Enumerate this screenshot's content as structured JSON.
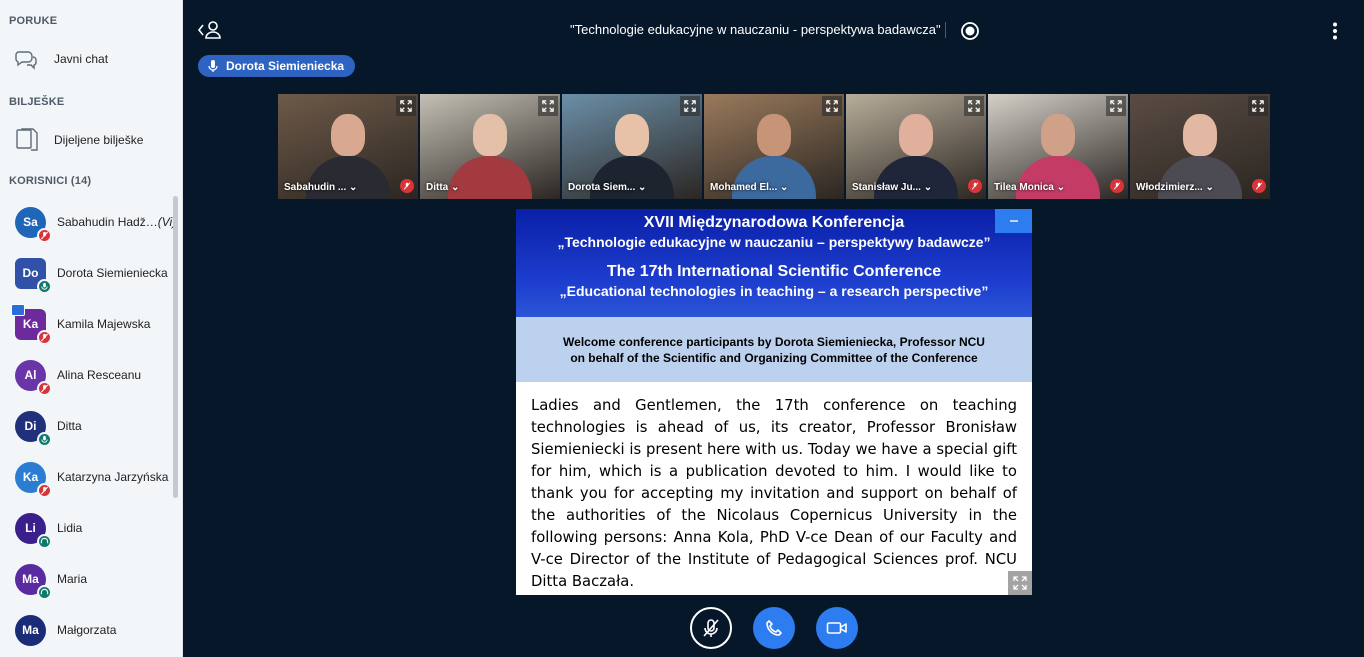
{
  "sidebar": {
    "messages_title": "PORUKE",
    "public_chat_label": "Javni chat",
    "notes_title": "BILJEŠKE",
    "shared_notes_label": "Dijeljene bilješke",
    "users_title": "KORISNICI (14)",
    "users": [
      {
        "initials": "Sa",
        "name": "Sabahudin Hadž…",
        "suffix": "(Vi)",
        "color": "#1f66b8",
        "status": "muted"
      },
      {
        "initials": "Do",
        "name": "Dorota Siemieniecka",
        "suffix": "",
        "color": "#3150a8",
        "status": "live",
        "shape": "square"
      },
      {
        "initials": "Ka",
        "name": "Kamila Majewska",
        "suffix": "",
        "color": "#6c2a9c",
        "status": "muted",
        "shape": "square",
        "presenter": true
      },
      {
        "initials": "Al",
        "name": "Alina Resceanu",
        "suffix": "",
        "color": "#6a35a8",
        "status": "muted"
      },
      {
        "initials": "Di",
        "name": "Ditta",
        "suffix": "",
        "color": "#20307a",
        "status": "live"
      },
      {
        "initials": "Ka",
        "name": "Katarzyna Jarzyńska",
        "suffix": "",
        "color": "#2c7dd2",
        "status": "muted"
      },
      {
        "initials": "Li",
        "name": "Lidia",
        "suffix": "",
        "color": "#3b1f8c",
        "status": "listen"
      },
      {
        "initials": "Ma",
        "name": "Maria",
        "suffix": "",
        "color": "#5a2aa0",
        "status": "listen"
      },
      {
        "initials": "Ma",
        "name": "Małgorzata",
        "suffix": "",
        "color": "#1a2c78",
        "status": ""
      }
    ]
  },
  "header": {
    "meeting_title": "\"Technologie edukacyjne w nauczaniu - perspektywa badawcza\"",
    "talking_indicator": "Dorota Siemieniecka"
  },
  "videos": [
    {
      "name": "Sabahudin ...",
      "muted": true,
      "room": "#6e5a48",
      "skin": "#d8a890",
      "shirt": "#2a2a33"
    },
    {
      "name": "Ditta",
      "muted": false,
      "room": "#c4c0b5",
      "skin": "#e4c0a8",
      "shirt": "#a33a40"
    },
    {
      "name": "Dorota Siem...",
      "muted": false,
      "room": "#6b8fa8",
      "skin": "#e8c2a8",
      "shirt": "#1d2430",
      "active": true
    },
    {
      "name": "Mohamed El...",
      "muted": false,
      "room": "#9a7a5c",
      "skin": "#c89478",
      "shirt": "#3c6a9e"
    },
    {
      "name": "Stanisław Ju...",
      "muted": true,
      "room": "#b8ad9a",
      "skin": "#e0b09c",
      "shirt": "#20263a"
    },
    {
      "name": "Tilea Monica",
      "muted": true,
      "room": "#d4d0c8",
      "skin": "#d0a088",
      "shirt": "#c43c66"
    },
    {
      "name": "Włodzimierz...",
      "muted": true,
      "room": "#5a4c44",
      "skin": "#e2b8a2",
      "shirt": "#4c4a52"
    }
  ],
  "slide": {
    "title_pl": "XVII Międzynarodowa Konferencja",
    "subtitle_pl": "„Technologie edukacyjne w nauczaniu – perspektywy badawcze”",
    "title_en": "The 17th International Scientific Conference",
    "subtitle_en": "„Educational technologies in teaching – a research perspective”",
    "welcome_line1": "Welcome conference participants by Dorota Siemieniecka, Professor NCU",
    "welcome_line2": "on behalf of the Scientific and Organizing Committee of the Conference",
    "body": "Ladies and Gentlemen, the 17th conference on teaching technologies is ahead of us, its creator, Professor Bronisław Siemieniecki is present here with us. Today we have a special gift for him, which is a publication devoted to him. I would like to thank you for accepting my invitation and support on behalf of the authorities of the Nicolaus Copernicus University in the following persons: Anna Kola, PhD V-ce  Dean of our Faculty and V-ce Director of the Institute of Pedagogical Sciences prof. NCU Ditta Baczała."
  },
  "colors": {
    "background": "#06172a",
    "accent": "#2d7df0",
    "muted": "#d9343a",
    "live": "#0f7a6c"
  }
}
